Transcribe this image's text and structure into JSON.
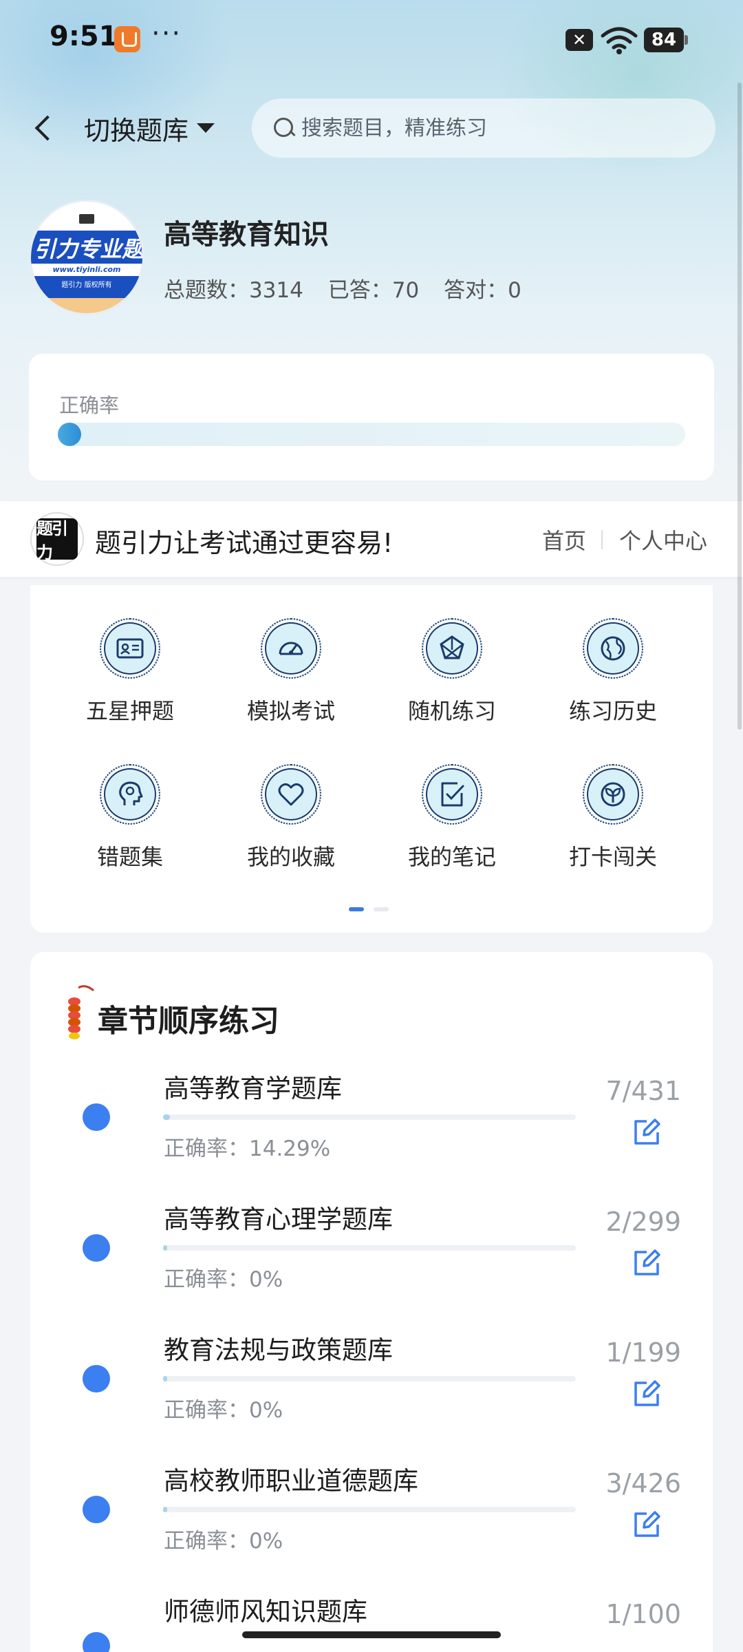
{
  "status_bar": {
    "time": "9:51",
    "dots": "···",
    "close_badge": "✕",
    "battery": "84"
  },
  "header": {
    "switch_label": "切换题库",
    "search_placeholder": "搜索题目，精准练习"
  },
  "logo": {
    "title": "引力专业题",
    "url": "www.tiyinli.com",
    "copyright": "题引力 版权所有"
  },
  "bank": {
    "title": "高等教育知识",
    "stats": [
      "总题数：3314",
      "已答：70",
      "答对：0"
    ]
  },
  "accuracy": {
    "label": "正确率",
    "value_fraction": 0.0
  },
  "brand": {
    "logo_text": "题引力",
    "slogan": "题引力让考试通过更容易!",
    "home": "首页",
    "personal": "个人中心"
  },
  "features": [
    {
      "label": "五星押题",
      "icon": "id-card-icon"
    },
    {
      "label": "模拟考试",
      "icon": "speedometer-icon"
    },
    {
      "label": "随机练习",
      "icon": "random-network-icon"
    },
    {
      "label": "练习历史",
      "icon": "globe-icon"
    },
    {
      "label": "错题集",
      "icon": "head-profile-icon"
    },
    {
      "label": "我的收藏",
      "icon": "heart-icon"
    },
    {
      "label": "我的笔记",
      "icon": "checked-note-icon"
    },
    {
      "label": "打卡闯关",
      "icon": "sprout-icon"
    }
  ],
  "pager": {
    "pages": 2,
    "active": 0
  },
  "chapters": {
    "title": "章节顺序练习",
    "items": [
      {
        "name": "高等教育学题库",
        "accuracy": "正确率：14.29%",
        "count": "7/431",
        "progress": 0.016
      },
      {
        "name": "高等教育心理学题库",
        "accuracy": "正确率：0%",
        "count": "2/299",
        "progress": 0.007
      },
      {
        "name": "教育法规与政策题库",
        "accuracy": "正确率：0%",
        "count": "1/199",
        "progress": 0.005
      },
      {
        "name": "高校教师职业道德题库",
        "accuracy": "正确率：0%",
        "count": "3/426",
        "progress": 0.007
      },
      {
        "name": "师德师风知识题库",
        "accuracy": "",
        "count": "1/100",
        "progress": 0.01
      }
    ]
  },
  "colors": {
    "accent": "#3b7ff0",
    "bar_fill": "#2b8fd6",
    "icon_bg": "#d8f1f8"
  }
}
